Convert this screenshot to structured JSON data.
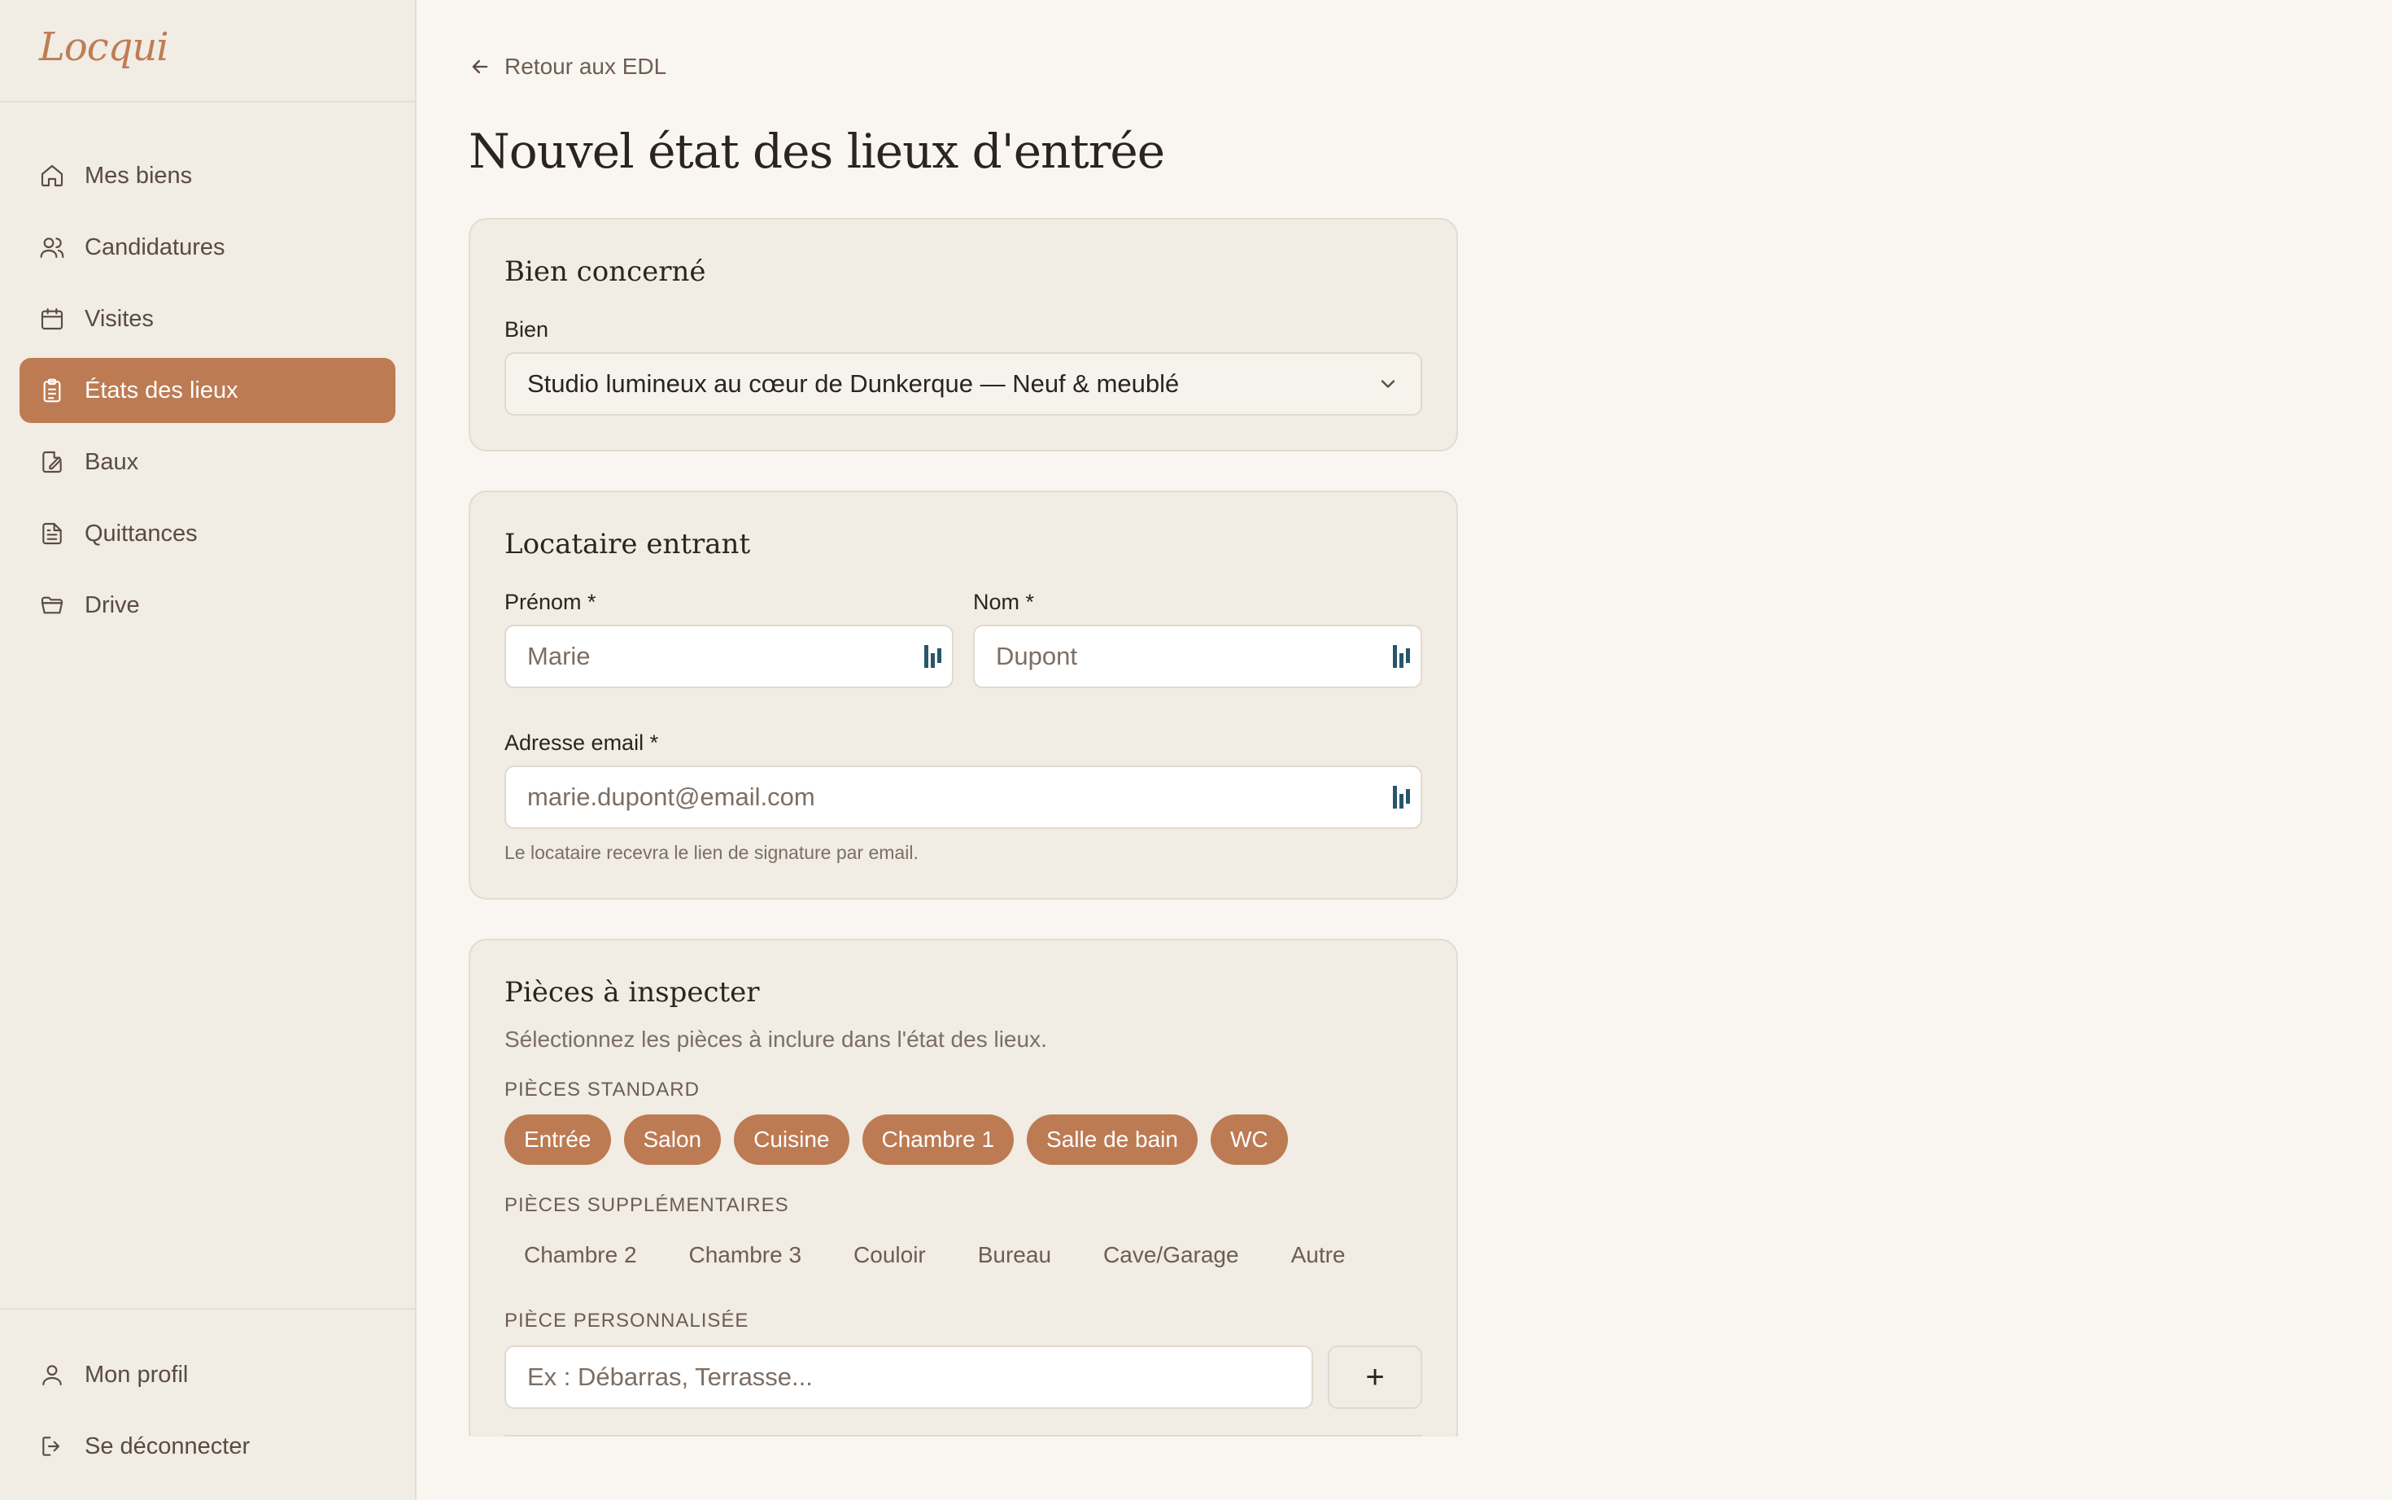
{
  "app": {
    "logo": "Locqui"
  },
  "sidebar": {
    "items": [
      {
        "label": "Mes biens",
        "icon": "home-icon"
      },
      {
        "label": "Candidatures",
        "icon": "users-icon"
      },
      {
        "label": "Visites",
        "icon": "calendar-icon"
      },
      {
        "label": "États des lieux",
        "icon": "clipboard-icon",
        "active": true
      },
      {
        "label": "Baux",
        "icon": "edit-document-icon"
      },
      {
        "label": "Quittances",
        "icon": "receipt-icon"
      },
      {
        "label": "Drive",
        "icon": "folder-icon"
      }
    ],
    "bottom": [
      {
        "label": "Mon profil",
        "icon": "user-icon"
      },
      {
        "label": "Se déconnecter",
        "icon": "logout-icon"
      }
    ]
  },
  "header": {
    "back_label": "Retour aux EDL",
    "title": "Nouvel état des lieux d'entrée"
  },
  "bien": {
    "title": "Bien concerné",
    "label": "Bien",
    "selected": "Studio lumineux au cœur de Dunkerque — Neuf & meublé"
  },
  "locataire": {
    "title": "Locataire entrant",
    "prenom_label": "Prénom *",
    "prenom_placeholder": "Marie",
    "nom_label": "Nom *",
    "nom_placeholder": "Dupont",
    "email_label": "Adresse email *",
    "email_placeholder": "marie.dupont@email.com",
    "help": "Le locataire recevra le lien de signature par email."
  },
  "pieces": {
    "title": "Pièces à inspecter",
    "subtitle": "Sélectionnez les pièces à inclure dans l'état des lieux.",
    "standard_label": "PIÈCES STANDARD",
    "standard": [
      "Entrée",
      "Salon",
      "Cuisine",
      "Chambre 1",
      "Salle de bain",
      "WC"
    ],
    "supp_label": "PIÈCES SUPPLÉMENTAIRES",
    "supplementaires": [
      "Chambre 2",
      "Chambre 3",
      "Couloir",
      "Bureau",
      "Cave/Garage",
      "Autre"
    ],
    "custom_label": "PIÈCE PERSONNALISÉE",
    "custom_placeholder": "Ex : Débarras, Terrasse...",
    "add_label": "+"
  },
  "colors": {
    "accent": "#bd7b53",
    "sidebar_bg": "#f1ece4",
    "page_bg": "#f9f6f1"
  }
}
